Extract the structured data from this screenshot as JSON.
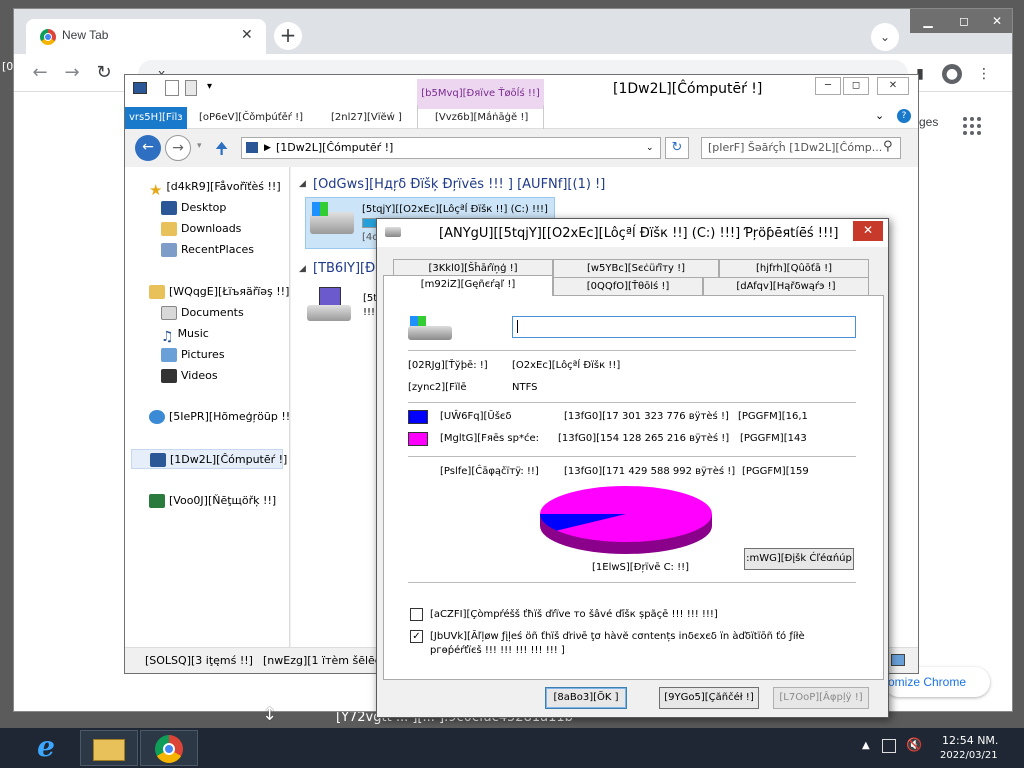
{
  "desktop": {
    "background_text": "[Y72vgtt ... ][... ].9c0cfac45281a11b",
    "left_fragment": "[0"
  },
  "chrome": {
    "tab_title": "New Tab",
    "tab_close": "✕",
    "new_tab": "+",
    "address_text": "x",
    "window_controls": [
      "▁",
      "◻",
      "✕"
    ],
    "apps_partial": "ges",
    "customize": "omize Chrome"
  },
  "explorer": {
    "title": "[1Dw2L][Ĉómрutēŕ !]",
    "ribbon": {
      "context_tab": "[b5Mvq][Đяïve Ťøōĺś !!]",
      "file_tab": "vrs5H][Fïlз",
      "tabs": [
        "[oP6eV][Čǒmþúťěŕ !]",
        "[2nl27][Vïĕẃ ]",
        "[Vvz6b][Mắṅāġĕ !]"
      ]
    },
    "path": "[1Dw2L][Ĉómрutēŕ !]",
    "search": "[pIerF] Šəāŕçĥ [1Dw2L][Ĉómр...",
    "sidebar": {
      "favorites": "[d4kR9][Fåvořïťèś !!]",
      "fav_items": [
        "Desktop",
        "Downloads",
        "RecentPlaces"
      ],
      "libraries": "[WQqgE][Łïъяäřïəş !!]",
      "lib_items": [
        "Documents",
        "Music",
        "Pictures",
        "Videos"
      ],
      "homegroup": "[5IePR][Hõmeģŗöūp !!]",
      "computer": "[1Dw2L][Ĉómрutēŕ !]",
      "network": "[Voo0J][Ňēţщöřķ !!]"
    },
    "content": {
      "group_hdd": "[OdGws][Hдŗδ Ðïšķ Ðŗïvēs !!! ] [AUFNf][(1) !]",
      "drive_c": "[5tqjY][[O2xEc][Lôçªĺ Ðïšк !!] (C:) !!!]",
      "drive_c_sub": "[4c",
      "group_removable": "[TB6IY][Ðe",
      "drive_r": "[5t",
      "drive_r_sub": "!!! ]"
    },
    "status": {
      "items": "[SOLSQ][3 iţęmś !!]",
      "selected": "[nwEzg][1 ïтèm šēlēctēd]"
    }
  },
  "dialog": {
    "title": "[ANYgU][[5tqjY][[O2xEc][Lôçªĺ Ðïšк !!] (C:) !!!] Ƥŗöƥēяtíēś !!!]",
    "close": "✕",
    "tabs_row1": [
      "[3Kkl0][Šĥāŕïņģ !]",
      "[w5YBc][Sєċüŕîтy !]",
      "[hjfrh][Qûōťā !]"
    ],
    "tabs_row2": [
      "[m92iZ][Gęñєŕąľ !]",
      "[0QQfO][Ťθōlś !]",
      "[dAfqv][Hąřδwąŕэ !]"
    ],
    "label_input": "",
    "type_label": "[02RJg][Ťўþē: !]",
    "type_value": "[O2xEc][Lôçªĺ Ðïšк !!]",
    "fs_label": "[zync2][Fïlē",
    "fs_value": "NTFS",
    "used": {
      "label": "[UŴ6Fq][Ūšєδ",
      "bytes": "[13fG0][17 301 323 776 вÿтèś !]",
      "size": "[PGGFM][16,1"
    },
    "free": {
      "label": "[MgltG][Fяēs sp*ćе:",
      "bytes": "[13fG0][154 128 265 216 вÿтèś !]",
      "size": "[PGGFM][143"
    },
    "capacity": {
      "label": "[Pslfe][Ĉāφąčïтÿ: !!]",
      "bytes": "[13fG0][171 429 588 992 вÿтèś !]",
      "size": "[PGGFM][159"
    },
    "cleanup": ":mWG][Ðįšk Ćľéαńúр",
    "drive_label": "[1ElwS][Ðŗïvē C: !!]",
    "compress": "[aCZFI][Çòmpŕéšš ťħïš ďŕïve тo šâvé ďīšк ṣpãçē !!! !!! !!!]",
    "index": "[JbUVk][Āľļøw ƒįļeś öñ ťhïš ďriνē ţσ hàvĕ сσntеnțs inδєxєδ ïn àďδïtïōñ ťό ƒíłè",
    "index2": "pгөṕéŕťïєš !!! !!! !!! !!! !!! ]",
    "ok": "[8aBo3][ÕΚ ]",
    "cancel": "[9YGo5][Çăñčéł !]",
    "apply": "[L7OoP][Âφрļÿ !]",
    "used_fraction": 0.1009,
    "colors": {
      "used": "#0000ff",
      "free": "#ff00ff"
    }
  },
  "taskbar": {
    "time": "12:54 NM.",
    "date": "2022/03/21"
  }
}
